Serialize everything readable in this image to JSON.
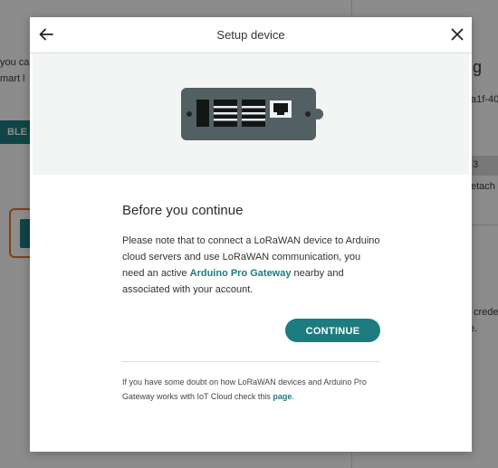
{
  "background": {
    "left_text_1": "you ca",
    "left_text_2": "mart l",
    "left_button": "BLE",
    "right_big": "g",
    "right_id": "a1f-40",
    "right_small": "3",
    "right_detach": "etach",
    "right_cred": "crede",
    "right_e": "e."
  },
  "modal": {
    "title": "Setup device",
    "back_icon": "arrow-left-icon",
    "close_icon": "close-icon",
    "device_illustration": "lorawan-device-icon",
    "heading": "Before you continue",
    "body_pre": "Please note that to connect a LoRaWAN device to Arduino cloud servers and use LoRaWAN communication, you need an active ",
    "body_link": "Arduino Pro Gateway",
    "body_post": " nearby and associated with your account.",
    "continue_label": "CONTINUE",
    "footnote_pre": "If you have some doubt on how LoRaWAN devices and Arduino Pro Gateway works with IoT Cloud check this ",
    "footnote_link": "page",
    "footnote_post": "."
  },
  "colors": {
    "accent": "#1d7c80",
    "device_body": "#525f63"
  }
}
